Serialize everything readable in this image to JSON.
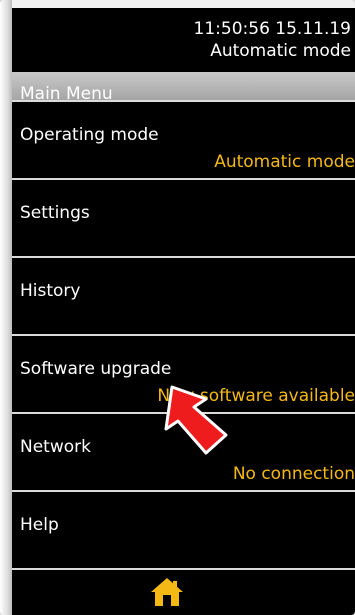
{
  "status": {
    "time_date": "11:50:56 15.11.19",
    "mode": "Automatic mode"
  },
  "menu": {
    "title": "Main Menu",
    "items": [
      {
        "label": "Operating mode",
        "value": "Automatic mode"
      },
      {
        "label": "Settings",
        "value": ""
      },
      {
        "label": "History",
        "value": ""
      },
      {
        "label": "Software upgrade",
        "value": "New software available"
      },
      {
        "label": "Network",
        "value": "No connection"
      },
      {
        "label": "Help",
        "value": ""
      }
    ]
  },
  "icons": {
    "home": "home-icon",
    "annotation": "red-arrow-icon"
  },
  "colors": {
    "background": "#000000",
    "text": "#ffffff",
    "accent": "#f5b915",
    "menubar": "#b5b5b5",
    "arrow": "#ee1c1c"
  }
}
